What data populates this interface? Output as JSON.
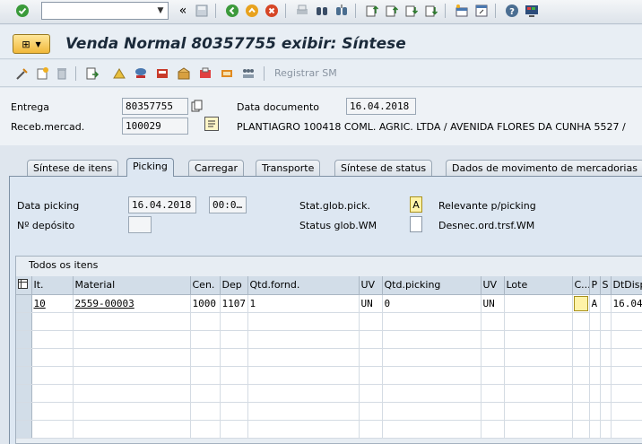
{
  "title": "Venda Normal 80357755 exibir: Síntese",
  "systoolbar": {
    "command_value": "",
    "icons": [
      "enter-icon",
      "back-nav-icon",
      "save-icon",
      "back-icon",
      "exit-icon",
      "cancel-icon",
      "print-icon",
      "find-icon",
      "find-next-icon",
      "first-page-icon",
      "prev-page-icon",
      "next-page-icon",
      "last-page-icon",
      "create-session-icon",
      "shortcut-icon",
      "help-icon",
      "customize-icon"
    ]
  },
  "apptoolbar": {
    "registrar_label": "Registrar SM"
  },
  "header": {
    "entrega_label": "Entrega",
    "entrega_value": "80357755",
    "data_documento_label": "Data documento",
    "data_documento_value": "16.04.2018",
    "receb_label": "Receb.mercad.",
    "receb_value": "100029",
    "receb_text": "PLANTIAGRO 100418 COML. AGRIC. LTDA / AVENIDA FLORES DA CUNHA 5527 /"
  },
  "tabs": [
    {
      "label": "Síntese de itens"
    },
    {
      "label": "Picking"
    },
    {
      "label": "Carregar"
    },
    {
      "label": "Transporte"
    },
    {
      "label": "Síntese de status"
    },
    {
      "label": "Dados de movimento de mercadorias"
    }
  ],
  "picking": {
    "data_picking_label": "Data picking",
    "data_picking_value": "16.04.2018",
    "time_value": "00:0…",
    "deposito_label": "Nº depósito",
    "deposito_value": "",
    "stat_glob_label": "Stat.glob.pick.",
    "stat_glob_value": "A",
    "stat_glob_text": "Relevante p/picking",
    "status_wm_label": "Status glob.WM",
    "status_wm_value": "",
    "status_wm_text": "Desnec.ord.trsf.WM"
  },
  "table": {
    "title": "Todos os itens",
    "columns": [
      "It.",
      "Material",
      "Cen.",
      "Dep",
      "Qtd.fornd.",
      "UV",
      "Qtd.picking",
      "UV",
      "Lote",
      "C...",
      "P",
      "S",
      "DtDisp"
    ],
    "rows": [
      [
        "10",
        "2559-00003",
        "1000",
        "1107",
        "1",
        "UN",
        "0",
        "UN",
        "",
        "",
        "A",
        "",
        "16.04"
      ]
    ]
  }
}
